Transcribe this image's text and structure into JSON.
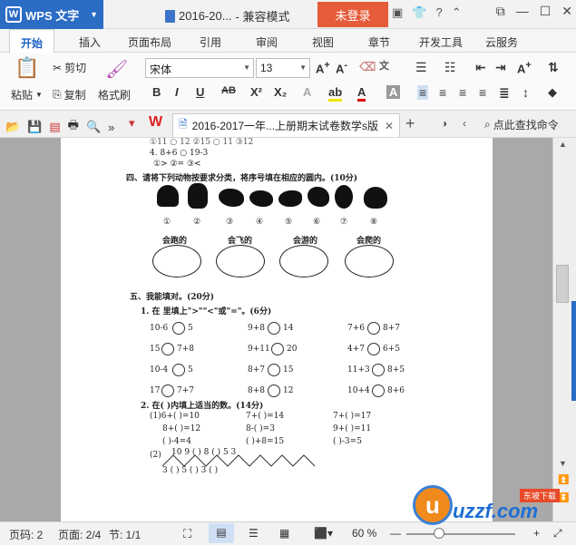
{
  "app": {
    "name": "WPS 文字",
    "logo_letter": "W"
  },
  "titlebar": {
    "doc_title": "2016-20...",
    "compat_mode": "- 兼容模式",
    "login_label": "未登录",
    "help": "?"
  },
  "menu_tabs": [
    "开始",
    "插入",
    "页面布局",
    "引用",
    "审阅",
    "视图",
    "章节",
    "开发工具",
    "云服务"
  ],
  "ribbon": {
    "paste": "粘贴",
    "cut": "剪切",
    "copy": "复制",
    "format_painter": "格式刷",
    "font_name": "宋体",
    "font_size": "13"
  },
  "doc_tab": {
    "title": "2016-2017一年...上册期末试卷数学s版"
  },
  "search": {
    "label": "点此查找命令"
  },
  "document": {
    "line1": "①11 ○ 12            ②15 ○ 11                  ③12",
    "line2": "4. 8+6 ○ 19-3",
    "line3": "①>                  ②=                        ③<",
    "q4": "四、请将下列动物按要求分类，将序号填在相应的圆内。(10分)",
    "nums": [
      "①",
      "②",
      "③",
      "④",
      "⑤",
      "⑥",
      "⑦",
      "⑧"
    ],
    "groups": [
      "会跑的",
      "会飞的",
      "会游的",
      "会爬的"
    ],
    "q5": "五、我能填对。(20分)",
    "q5_1": "1. 在      里填上\">\"\"<\"或\"=\"。(6分)",
    "compare_rows": [
      [
        "10-6",
        "5",
        "9+8",
        "14",
        "7+6",
        "8+7"
      ],
      [
        "15",
        "7+8",
        "9+11",
        "20",
        "4+7",
        "6+5"
      ],
      [
        "10-4",
        "5",
        "8+7",
        "15",
        "11+3",
        "8+5"
      ],
      [
        "17",
        "7+7",
        "8+8",
        "12",
        "10+4",
        "8+6"
      ]
    ],
    "q5_2": "2. 在(    )内填上适当的数。(14分)",
    "fill_rows": [
      [
        "(1)6+(      )=10",
        "7+(      )=14",
        "7+(      )=17"
      ],
      [
        "8+(      )=12",
        "8-(      )=3",
        "9+(      )=11"
      ],
      [
        "(      )-4=4",
        "(      )+8=15",
        "(      )-3=5"
      ]
    ],
    "seq_label": "(2)",
    "seq_top": "10    9   (    )    8   (    )    5    3",
    "seq_bottom": "3  (    )     5  (    )    3  (    )"
  },
  "status": {
    "page_code": "页码: 2",
    "page": "页面: 2/4",
    "section": "节: 1/1",
    "zoom": "60 %"
  },
  "watermark": {
    "text": "uzzf.com",
    "sub": "东坡下载"
  },
  "colors": {
    "accent": "#2b6cc4",
    "login": "#e65c3a"
  }
}
